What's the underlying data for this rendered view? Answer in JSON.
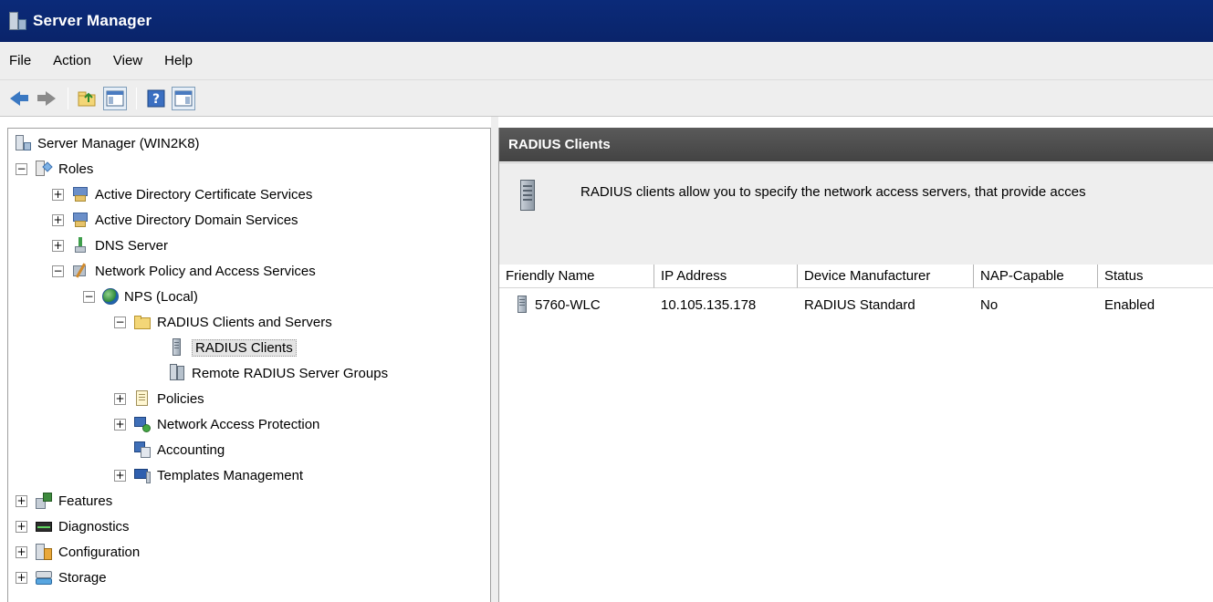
{
  "window": {
    "title": "Server Manager"
  },
  "menu": [
    "File",
    "Action",
    "View",
    "Help"
  ],
  "toolbar": {
    "icons": [
      "back-arrow-icon",
      "forward-arrow-icon",
      "up-folder-icon",
      "show-hide-console-tree-icon",
      "help-icon",
      "show-hide-action-pane-icon"
    ]
  },
  "tree": {
    "root": "Server Manager (WIN2K8)",
    "roles": "Roles",
    "ad_cert": "Active Directory Certificate Services",
    "ad_domain": "Active Directory Domain Services",
    "dns": "DNS Server",
    "npas": "Network Policy and Access Services",
    "nps_local": "NPS (Local)",
    "radius_cs": "RADIUS Clients and Servers",
    "radius_clients": "RADIUS Clients",
    "remote_groups": "Remote RADIUS Server Groups",
    "policies": "Policies",
    "nap": "Network Access Protection",
    "accounting": "Accounting",
    "templates": "Templates Management",
    "features": "Features",
    "diagnostics": "Diagnostics",
    "configuration": "Configuration",
    "storage": "Storage"
  },
  "pane": {
    "title": "RADIUS Clients",
    "description": "RADIUS clients allow you to specify the network access servers, that provide acces"
  },
  "table": {
    "headers": [
      "Friendly Name",
      "IP Address",
      "Device Manufacturer",
      "NAP-Capable",
      "Status"
    ],
    "rows": [
      {
        "friendly_name": "5760-WLC",
        "ip": "10.105.135.178",
        "manufacturer": "RADIUS Standard",
        "nap": "No",
        "status": "Enabled"
      }
    ]
  }
}
